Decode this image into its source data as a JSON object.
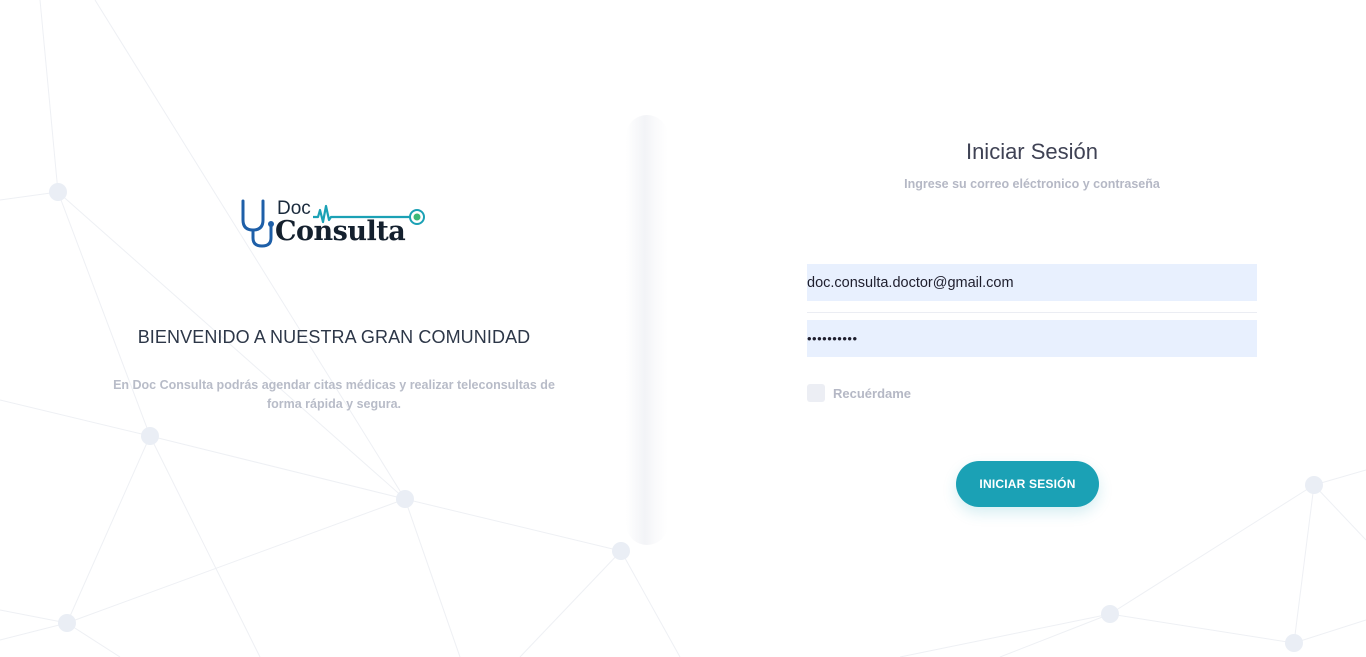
{
  "brand": {
    "logo_word_top": "Doc",
    "logo_word_bottom": "Consulta",
    "accent_color": "#1ba1b5"
  },
  "welcome": {
    "title": "BIENVENIDO A NUESTRA GRAN COMUNIDAD",
    "description": "En Doc Consulta podrás agendar citas médicas y realizar teleconsultas de forma rápida y segura."
  },
  "login": {
    "title": "Iniciar Sesión",
    "subtitle": "Ingrese su correo eléctronico y contraseña",
    "email_value": "doc.consulta.doctor@gmail.com",
    "password_masked": "••••••••••",
    "remember_label": "Recuérdame",
    "remember_checked": false,
    "submit_label": "INICIAR SESIÓN"
  },
  "icons": {
    "logo_mark": "stethoscope-heartbeat-icon",
    "checkbox": "checkbox-icon"
  }
}
